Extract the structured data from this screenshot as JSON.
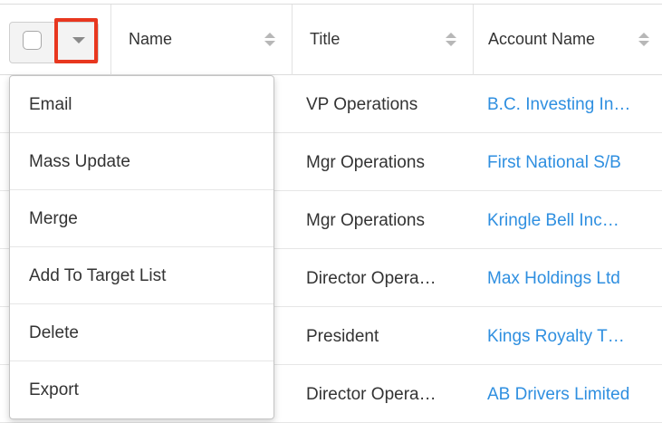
{
  "header": {
    "columns": [
      {
        "label": "Name"
      },
      {
        "label": "Title"
      },
      {
        "label": "Account Name"
      }
    ]
  },
  "rows": [
    {
      "title": "VP Operations",
      "account": "B.C. Investing In…"
    },
    {
      "title": "Mgr Operations",
      "account": "First National S/B"
    },
    {
      "title": "Mgr Operations",
      "account": "Kringle Bell Inc…"
    },
    {
      "title": "Director Opera…",
      "account": "Max Holdings Ltd"
    },
    {
      "title": "President",
      "account": "Kings Royalty T…"
    },
    {
      "title": "Director Opera…",
      "account": "AB Drivers Limited"
    }
  ],
  "actions_menu": {
    "items": [
      "Email",
      "Mass Update",
      "Merge",
      "Add To Target List",
      "Delete",
      "Export"
    ]
  },
  "colors": {
    "link": "#2f8fe0",
    "highlight": "#e8371f"
  },
  "icons": {
    "select_all": "checkbox-icon",
    "actions": "caret-down-icon",
    "sort": "sort-icon"
  }
}
